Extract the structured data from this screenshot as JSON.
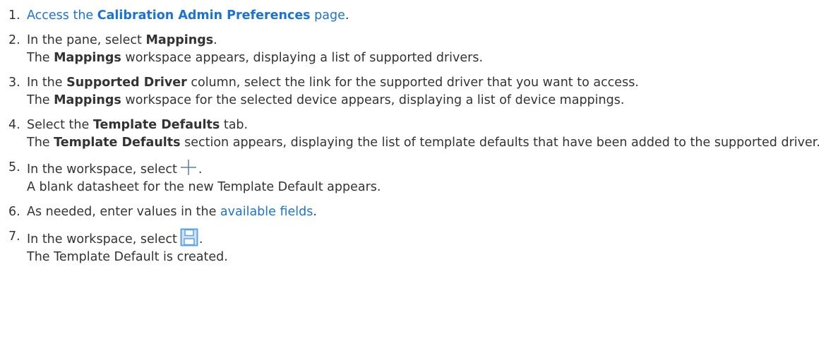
{
  "steps": [
    {
      "num": "1.",
      "pre": "Access the ",
      "bold": "Calibration Admin Preferences",
      "post": " page",
      "tail": "."
    },
    {
      "num": "2.",
      "pre": "In the pane, select ",
      "bold": "Mappings",
      "post": ".",
      "result_bold": "Mappings",
      "result": " workspace appears, displaying a list of supported drivers.",
      "result_pre": "The "
    },
    {
      "num": "3.",
      "pre": "In the ",
      "bold": "Supported Driver",
      "post": " column, select the link for the supported driver that you want to access.",
      "result_pre": "The ",
      "result_bold": "Mappings",
      "result": " workspace for the selected device appears, displaying a list of device mappings."
    },
    {
      "num": "4.",
      "pre": "Select the ",
      "bold": "Template Defaults",
      "post": " tab.",
      "result_pre": "The ",
      "result_bold": "Template Defaults",
      "result": " section appears, displaying the list of template defaults that have been added to the supported driver."
    },
    {
      "num": "5.",
      "pre": "In the workspace, select",
      "post": ".",
      "icon": "plus-icon",
      "result": "A blank datasheet for the new Template Default appears."
    },
    {
      "num": "6.",
      "pre": "As needed, enter values in the ",
      "link": "available fields",
      "post": "."
    },
    {
      "num": "7.",
      "pre": "In the workspace, select",
      "post": ".",
      "icon": "save-icon",
      "result": "The Template Default is created."
    }
  ],
  "colors": {
    "link": "#1a73d9",
    "text": "#333333",
    "icon_blue": "#5aa3e6"
  }
}
